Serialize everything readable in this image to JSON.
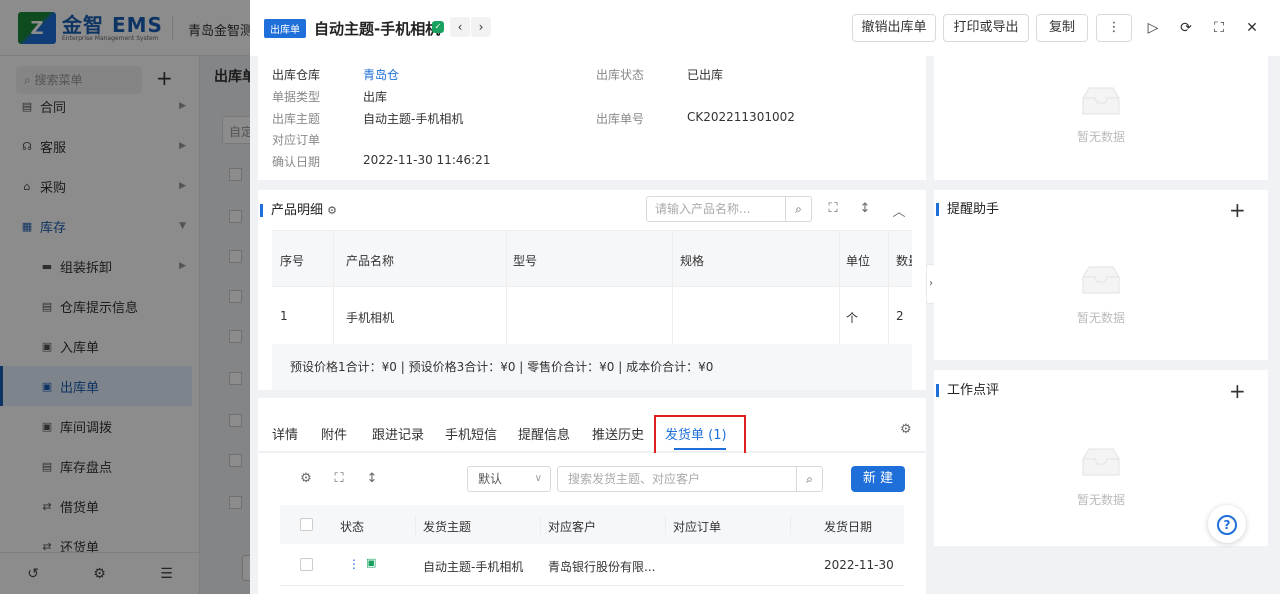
{
  "app": {
    "logo_text": "金智 EMS",
    "logo_sub": "Enterprise Management System",
    "company": "青岛金智测试",
    "search_menu_placeholder": "搜索菜单",
    "page_title": "出库单",
    "filter_text": "自定"
  },
  "sidebar": {
    "items": [
      {
        "label": "合同",
        "level": "top"
      },
      {
        "label": "客服",
        "level": "top"
      },
      {
        "label": "采购",
        "level": "top"
      },
      {
        "label": "库存",
        "level": "top"
      },
      {
        "label": "组装拆卸",
        "level": "sub"
      },
      {
        "label": "仓库提示信息",
        "level": "sub"
      },
      {
        "label": "入库单",
        "level": "sub"
      },
      {
        "label": "出库单",
        "level": "sub"
      },
      {
        "label": "库间调拨",
        "level": "sub"
      },
      {
        "label": "库存盘点",
        "level": "sub"
      },
      {
        "label": "借货单",
        "level": "sub"
      },
      {
        "label": "还货单",
        "level": "sub"
      }
    ]
  },
  "drawer": {
    "tag": "出库单",
    "title": "自动主题-手机相机",
    "buttons": {
      "cancel": "撤销出库单",
      "print": "打印或导出",
      "copy": "复制",
      "more": "⋮"
    }
  },
  "info": {
    "warehouse_label": "出库仓库",
    "warehouse_value": "青岛仓",
    "status_label": "出库状态",
    "status_value": "已出库",
    "type_label": "单据类型",
    "type_value": "出库",
    "subject_label": "出库主题",
    "subject_value": "自动主题-手机相机",
    "number_label": "出库单号",
    "number_value": "CK202211301002",
    "order_label": "对应订单",
    "confirm_label": "确认日期",
    "confirm_value": "2022-11-30 11:46:21"
  },
  "products": {
    "title": "产品明细",
    "search_placeholder": "请输入产品名称...",
    "columns": [
      "序号",
      "产品名称",
      "型号",
      "规格",
      "单位",
      "数量"
    ],
    "rows": [
      {
        "index": "1",
        "name": "手机相机",
        "model": "",
        "spec": "",
        "unit": "个",
        "qty": "2"
      }
    ],
    "footer": "预设价格1合计：¥0 | 预设价格3合计：¥0 | 零售价合计：¥0 | 成本价合计：¥0"
  },
  "tabs": {
    "items": [
      "详情",
      "附件",
      "跟进记录",
      "手机短信",
      "提醒信息",
      "推送历史",
      "发货单 (1)"
    ],
    "active_index": 6
  },
  "shipments": {
    "filter_value": "默认",
    "search_placeholder": "搜索发货主题、对应客户",
    "new_button": "新 建",
    "columns": [
      "状态",
      "发货主题",
      "对应客户",
      "对应订单",
      "发货日期"
    ],
    "rows": [
      {
        "subject": "自动主题-手机相机",
        "customer": "青岛银行股份有限...",
        "order": "",
        "date": "2022-11-30"
      }
    ]
  },
  "right_panels": {
    "empty_text": "暂无数据",
    "reminder_title": "提醒助手",
    "review_title": "工作点评"
  },
  "colors": {
    "primary": "#1e6fd9",
    "highlight_border": "#e02020",
    "status_green": "#19a15f"
  }
}
